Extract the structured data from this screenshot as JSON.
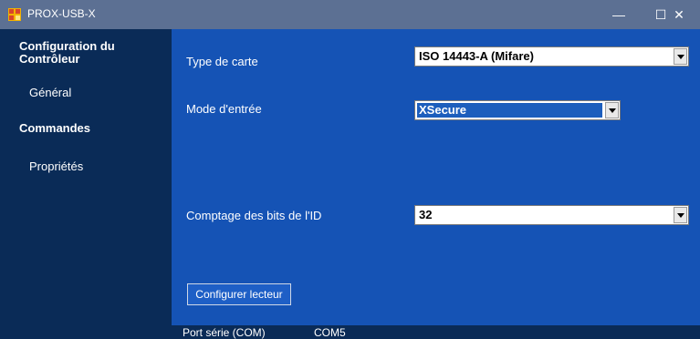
{
  "titlebar": {
    "title": "PROX-USB-X",
    "min_glyph": "—",
    "max_glyph": "☐",
    "close_glyph": "✕",
    "bg": "#5c7093"
  },
  "sidebar": {
    "section1_line1": "Configuration du",
    "section1_line2": "Contrôleur",
    "item_general": "Général",
    "section2": "Commandes",
    "item_properties": "Propriétés"
  },
  "form": {
    "card_type_label": "Type de carte",
    "card_type_value": "ISO 14443-A (Mifare)",
    "input_mode_label": "Mode d'entrée",
    "input_mode_value": "XSecure",
    "id_bits_label": "Comptage des bits de l'ID",
    "id_bits_value": "32",
    "configure_button": "Configurer lecteur"
  },
  "status": {
    "port_label": "Port série (COM)",
    "port_value": "COM5"
  },
  "colors": {
    "main_bg": "#1553b5",
    "sidebar_bg": "#0a2b57",
    "selected_bg": "#1e5aa8"
  },
  "icons": {
    "app": "app-icon"
  }
}
